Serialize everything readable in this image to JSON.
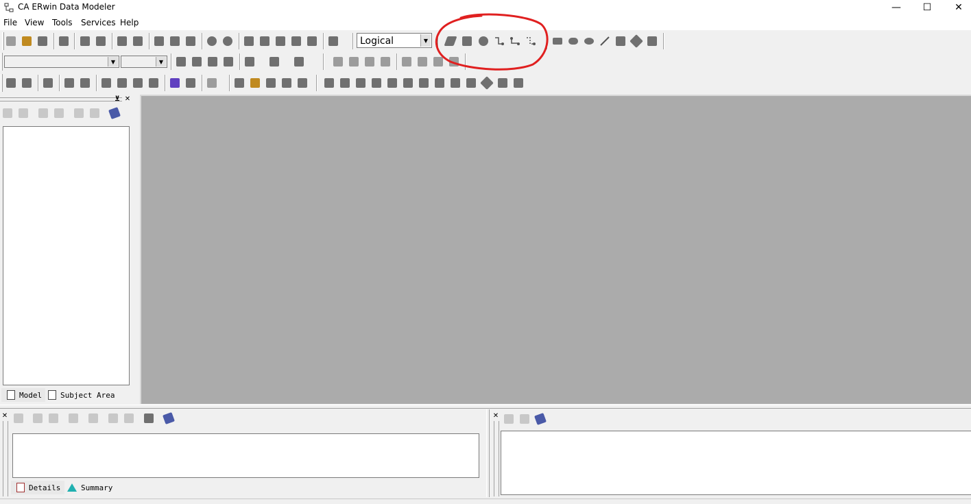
{
  "window": {
    "title": "CA ERwin Data Modeler",
    "controls": {
      "minimize": "—",
      "maximize": "☐",
      "close": "✕"
    }
  },
  "menu": [
    "File",
    "View",
    "Tools",
    "Services",
    "Help"
  ],
  "toolbar": {
    "model_view_combo": {
      "value": "Logical"
    },
    "font_combo": {
      "value": ""
    },
    "size_combo": {
      "value": ""
    }
  },
  "model_explorer": {
    "tabs": [
      {
        "label": "Model",
        "icon": "page-icon",
        "active": true
      },
      {
        "label": "Subject Area",
        "icon": "subject-area-icon",
        "active": false
      }
    ]
  },
  "bottom_left_pane": {
    "tabs": [
      {
        "label": "Details",
        "icon": "details-icon",
        "active": true
      },
      {
        "label": "Summary",
        "icon": "triangle-icon",
        "active": false
      }
    ]
  },
  "annotation": {
    "shape": "freehand red ellipse",
    "color": "#e02020"
  },
  "colors": {
    "canvas": "#ababab",
    "chrome": "#f0f0f0"
  }
}
